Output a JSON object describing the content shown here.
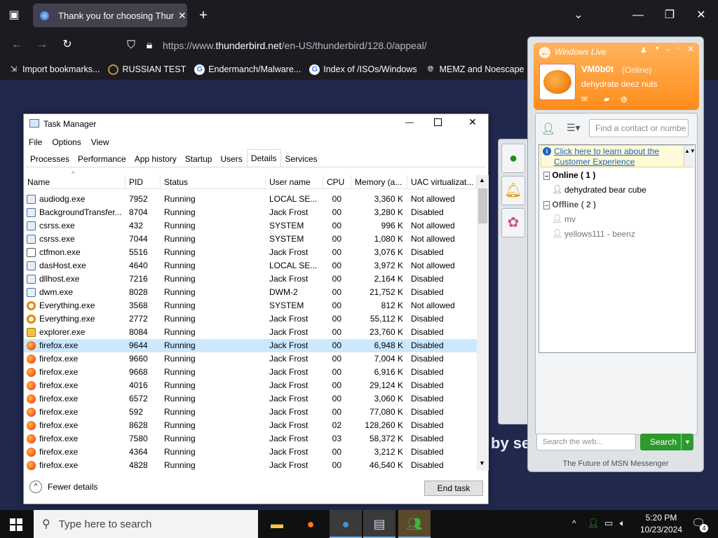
{
  "browser": {
    "tab_title": "Thank you for choosing Thunde",
    "url_prefix": "https://www.",
    "url_domain": "thunderbird.net",
    "url_path": "/en-US/thunderbird/128.0/appeal/",
    "bookmarks": [
      "Import bookmarks...",
      "RUSSIAN TEST",
      "Endermanch/Malware...",
      "Index of /ISOs/Windows",
      "MEMZ and Noescape ..."
    ],
    "page_text": "by se"
  },
  "taskmgr": {
    "title": "Task Manager",
    "menu": [
      "File",
      "Options",
      "View"
    ],
    "tabs": [
      "Processes",
      "Performance",
      "App history",
      "Startup",
      "Users",
      "Details",
      "Services"
    ],
    "selected_tab": "Details",
    "columns": [
      "Name",
      "PID",
      "Status",
      "User name",
      "CPU",
      "Memory (a...",
      "UAC virtualizat..."
    ],
    "rows": [
      {
        "icon": "exe",
        "name": "audiodg.exe",
        "pid": "7952",
        "status": "Running",
        "user": "LOCAL SE...",
        "cpu": "00",
        "mem": "3,360 K",
        "uac": "Not allowed"
      },
      {
        "icon": "exe",
        "name": "BackgroundTransfer...",
        "pid": "8704",
        "status": "Running",
        "user": "Jack Frost",
        "cpu": "00",
        "mem": "3,280 K",
        "uac": "Disabled"
      },
      {
        "icon": "exe",
        "name": "csrss.exe",
        "pid": "432",
        "status": "Running",
        "user": "SYSTEM",
        "cpu": "00",
        "mem": "996 K",
        "uac": "Not allowed"
      },
      {
        "icon": "exe",
        "name": "csrss.exe",
        "pid": "7044",
        "status": "Running",
        "user": "SYSTEM",
        "cpu": "00",
        "mem": "1,080 K",
        "uac": "Not allowed"
      },
      {
        "icon": "ctf",
        "name": "ctfmon.exe",
        "pid": "5516",
        "status": "Running",
        "user": "Jack Frost",
        "cpu": "00",
        "mem": "3,076 K",
        "uac": "Disabled"
      },
      {
        "icon": "exe",
        "name": "dasHost.exe",
        "pid": "4640",
        "status": "Running",
        "user": "LOCAL SE...",
        "cpu": "00",
        "mem": "3,972 K",
        "uac": "Not allowed"
      },
      {
        "icon": "exe",
        "name": "dllhost.exe",
        "pid": "7216",
        "status": "Running",
        "user": "Jack Frost",
        "cpu": "00",
        "mem": "2,164 K",
        "uac": "Disabled"
      },
      {
        "icon": "exe",
        "name": "dwm.exe",
        "pid": "8028",
        "status": "Running",
        "user": "DWM-2",
        "cpu": "00",
        "mem": "21,752 K",
        "uac": "Disabled"
      },
      {
        "icon": "ev",
        "name": "Everything.exe",
        "pid": "3568",
        "status": "Running",
        "user": "SYSTEM",
        "cpu": "00",
        "mem": "812 K",
        "uac": "Not allowed"
      },
      {
        "icon": "ev",
        "name": "Everything.exe",
        "pid": "2772",
        "status": "Running",
        "user": "Jack Frost",
        "cpu": "00",
        "mem": "55,112 K",
        "uac": "Disabled"
      },
      {
        "icon": "exp",
        "name": "explorer.exe",
        "pid": "8084",
        "status": "Running",
        "user": "Jack Frost",
        "cpu": "00",
        "mem": "23,760 K",
        "uac": "Disabled"
      },
      {
        "icon": "ff",
        "name": "firefox.exe",
        "pid": "9644",
        "status": "Running",
        "user": "Jack Frost",
        "cpu": "00",
        "mem": "6,948 K",
        "uac": "Disabled",
        "selected": true
      },
      {
        "icon": "ff",
        "name": "firefox.exe",
        "pid": "9660",
        "status": "Running",
        "user": "Jack Frost",
        "cpu": "00",
        "mem": "7,004 K",
        "uac": "Disabled"
      },
      {
        "icon": "ff",
        "name": "firefox.exe",
        "pid": "9668",
        "status": "Running",
        "user": "Jack Frost",
        "cpu": "00",
        "mem": "6,916 K",
        "uac": "Disabled"
      },
      {
        "icon": "ff",
        "name": "firefox.exe",
        "pid": "4016",
        "status": "Running",
        "user": "Jack Frost",
        "cpu": "00",
        "mem": "29,124 K",
        "uac": "Disabled"
      },
      {
        "icon": "ff",
        "name": "firefox.exe",
        "pid": "6572",
        "status": "Running",
        "user": "Jack Frost",
        "cpu": "00",
        "mem": "3,060 K",
        "uac": "Disabled"
      },
      {
        "icon": "ff",
        "name": "firefox.exe",
        "pid": "592",
        "status": "Running",
        "user": "Jack Frost",
        "cpu": "00",
        "mem": "77,080 K",
        "uac": "Disabled"
      },
      {
        "icon": "ff",
        "name": "firefox.exe",
        "pid": "8628",
        "status": "Running",
        "user": "Jack Frost",
        "cpu": "02",
        "mem": "128,260 K",
        "uac": "Disabled"
      },
      {
        "icon": "ff",
        "name": "firefox.exe",
        "pid": "7580",
        "status": "Running",
        "user": "Jack Frost",
        "cpu": "03",
        "mem": "58,372 K",
        "uac": "Disabled"
      },
      {
        "icon": "ff",
        "name": "firefox.exe",
        "pid": "4364",
        "status": "Running",
        "user": "Jack Frost",
        "cpu": "00",
        "mem": "3,212 K",
        "uac": "Disabled"
      },
      {
        "icon": "ff",
        "name": "firefox.exe",
        "pid": "4828",
        "status": "Running",
        "user": "Jack Frost",
        "cpu": "00",
        "mem": "46,540 K",
        "uac": "Disabled"
      }
    ],
    "fewer_details": "Fewer details",
    "end_task": "End task"
  },
  "messenger": {
    "brand": "Windows Live",
    "user_name": "VM0b0t",
    "user_status": "(Online)",
    "personal_message": "dehydrate deez nuts",
    "search_contact_placeholder": "Find a contact or numbe",
    "banner_line1": "Click here to learn about the",
    "banner_line2": "Customer Experience",
    "online_group": "Online ( 1 )",
    "online_contacts": [
      "dehydrated bear cube"
    ],
    "offline_group": "Offline ( 2 )",
    "offline_contacts": [
      "mv",
      "yellows111 - beenz"
    ],
    "web_search_placeholder": "Search the web...",
    "search_button": "Search",
    "footer": "The Future of MSN Messenger"
  },
  "taskbar": {
    "search_placeholder": "Type here to search",
    "time": "5:20 PM",
    "date": "10/23/2024",
    "notification_count": "4"
  }
}
